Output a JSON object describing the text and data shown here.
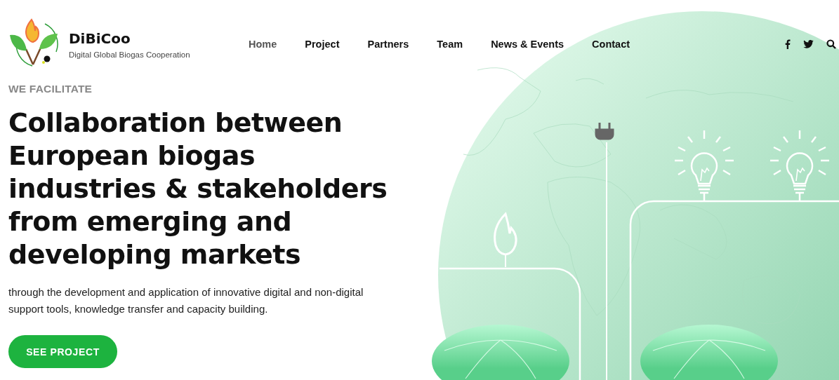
{
  "logo": {
    "name": "DiBiCoo",
    "tagline": "Digital Global Biogas Cooperation"
  },
  "nav": [
    {
      "label": "Home",
      "selected": true
    },
    {
      "label": "Project",
      "selected": false
    },
    {
      "label": "Partners",
      "selected": false
    },
    {
      "label": "Team",
      "selected": false
    },
    {
      "label": "News & Events",
      "selected": false
    },
    {
      "label": "Contact",
      "selected": false
    }
  ],
  "social": [
    {
      "kind": "facebook"
    },
    {
      "kind": "twitter"
    },
    {
      "kind": "search"
    }
  ],
  "hero": {
    "eyebrow": "WE FACILITATE",
    "heading": "Collaboration between European biogas industries & stakeholders from emerging and developing markets",
    "text": "through the development and application of innovative digital and non-digital support tools, knowledge transfer and capacity building.",
    "button": "SEE PROJECT"
  }
}
